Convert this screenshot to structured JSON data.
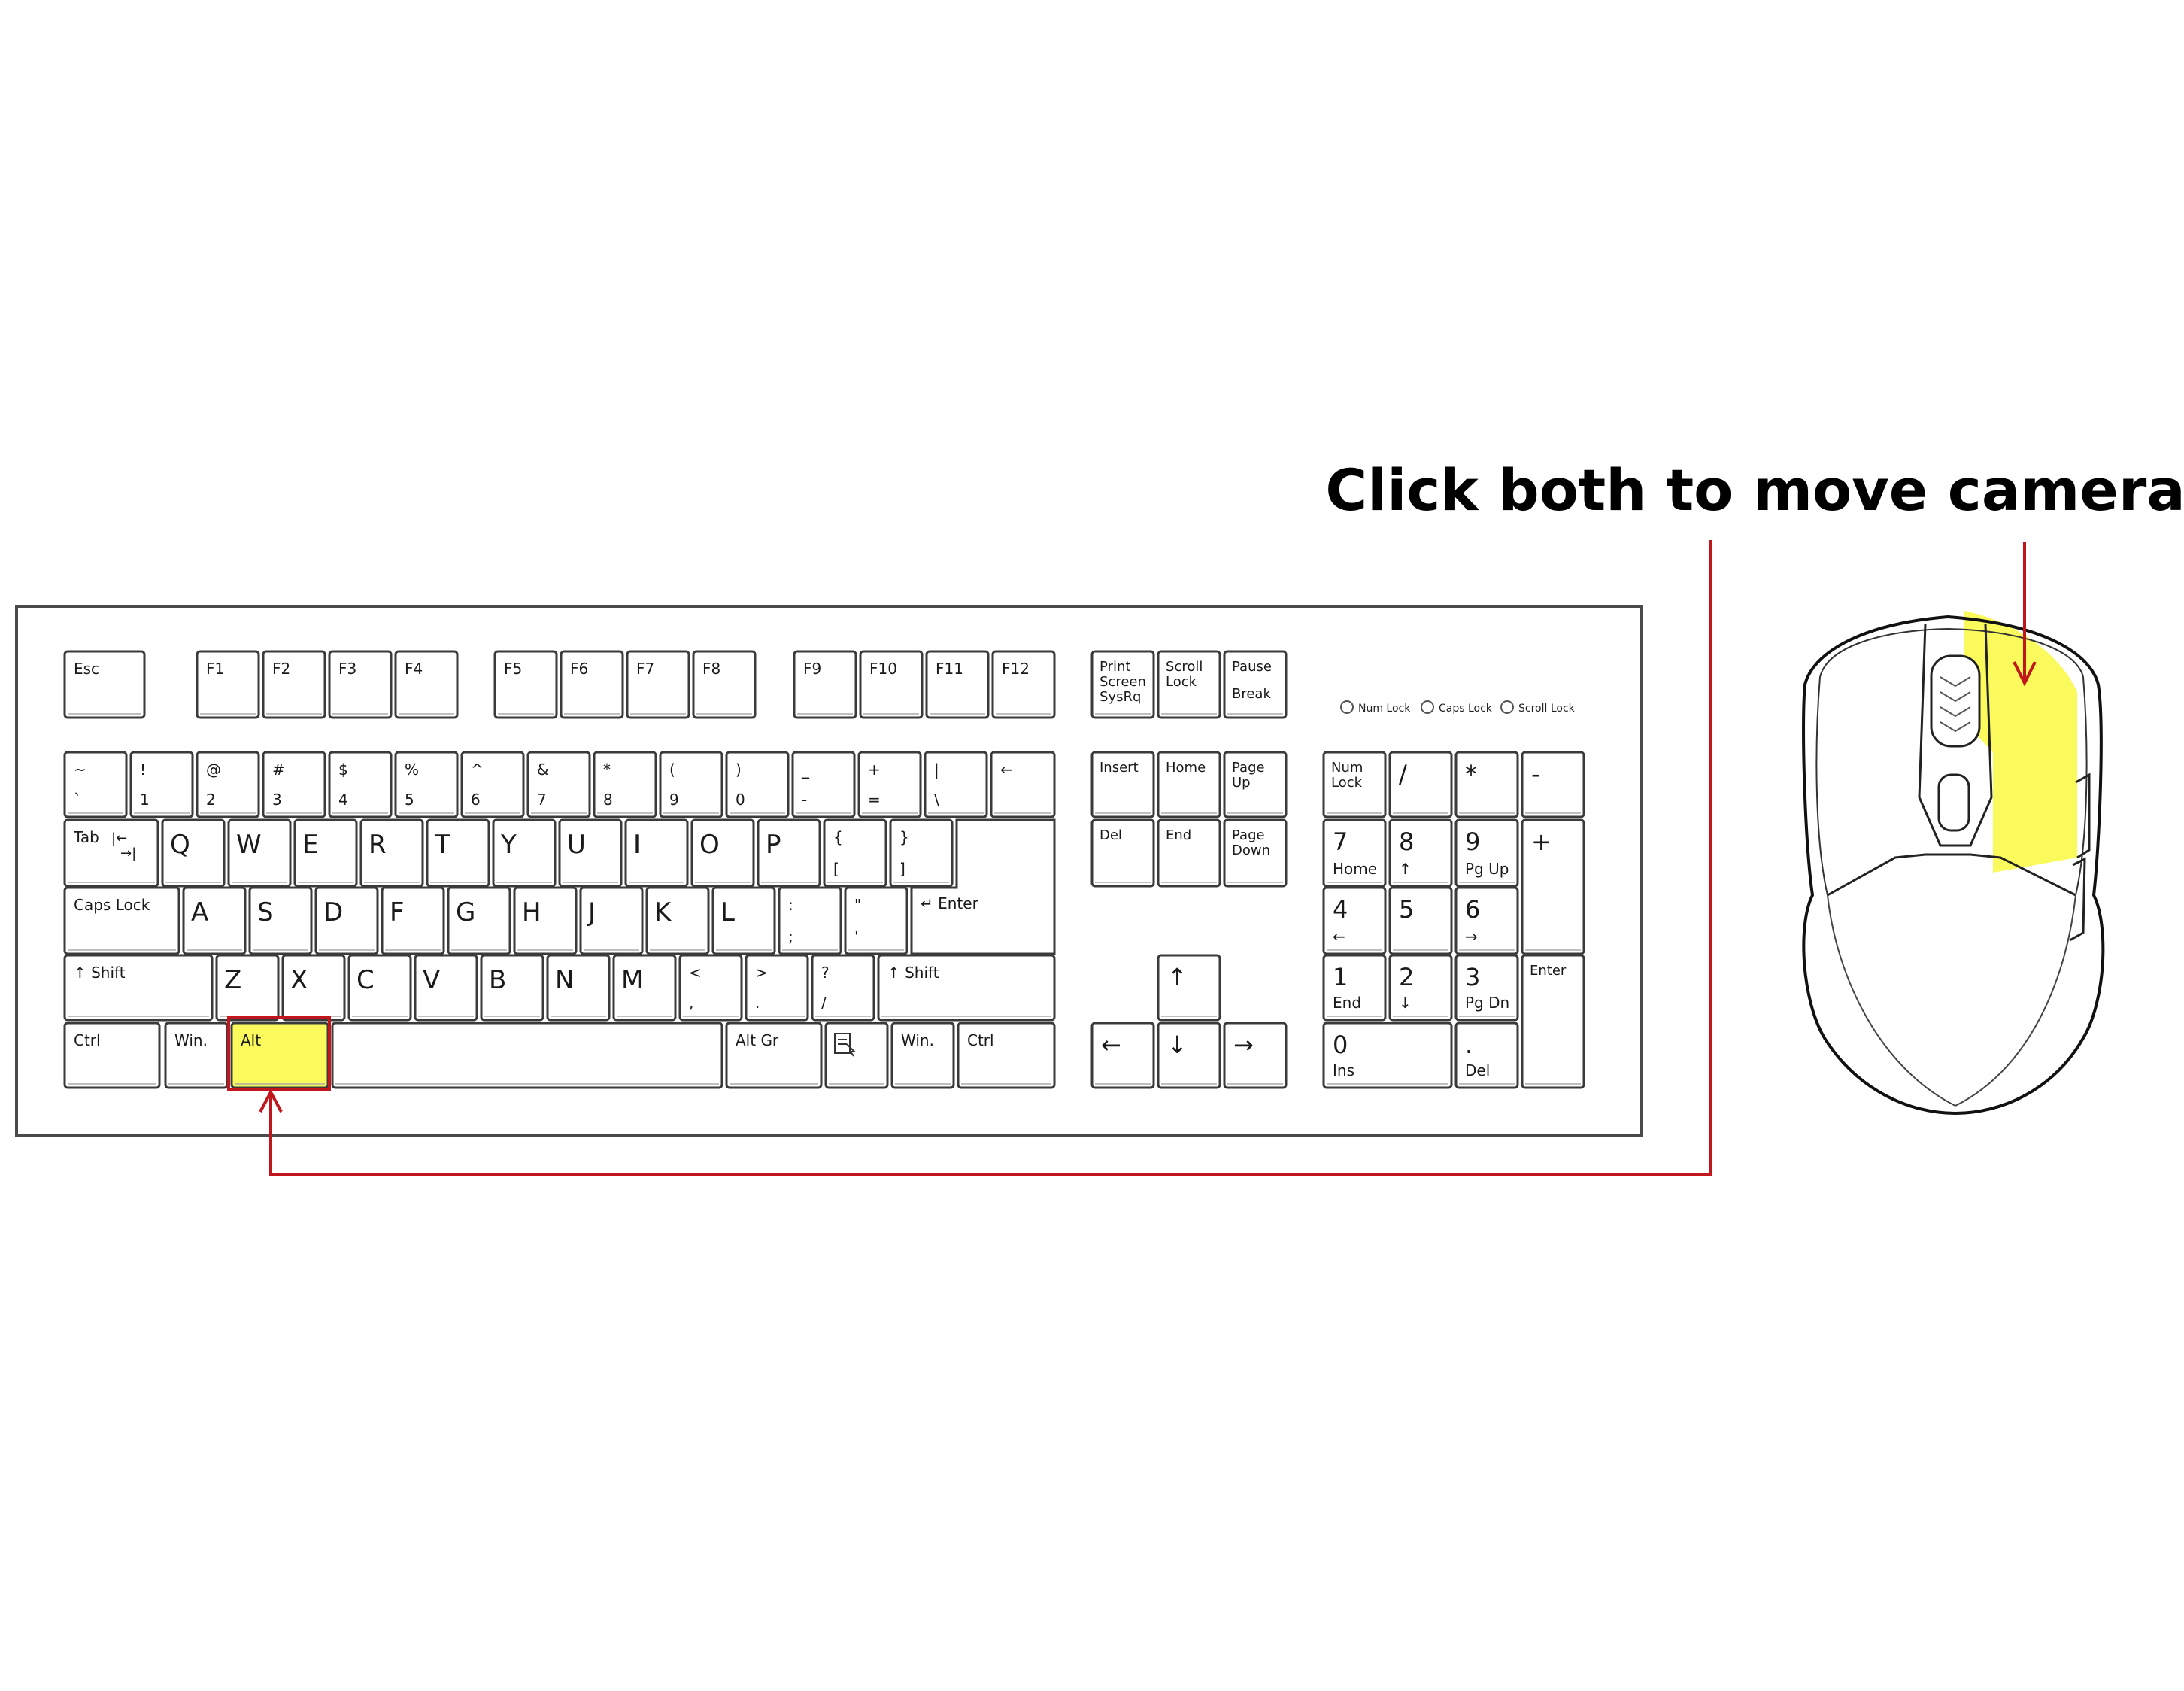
{
  "caption": "Click both to move camera",
  "colors": {
    "highlight": "#fbf94a",
    "arrow": "#c0161c",
    "outline": "#1a1a1a",
    "key_border": "#3a3a3a"
  },
  "indicators": [
    "Num Lock",
    "Caps Lock",
    "Scroll Lock"
  ],
  "keys": {
    "esc": "Esc",
    "f1": "F1",
    "f2": "F2",
    "f3": "F3",
    "f4": "F4",
    "f5": "F5",
    "f6": "F6",
    "f7": "F7",
    "f8": "F8",
    "f9": "F9",
    "f10": "F10",
    "f11": "F11",
    "f12": "F12",
    "prtsc_1": "Print",
    "prtsc_2": "Screen",
    "prtsc_3": "SysRq",
    "scroll_1": "Scroll",
    "scroll_2": "Lock",
    "pause_1": "Pause",
    "pause_2": "Break",
    "grave_top": "~",
    "grave_bot": "`",
    "n1_top": "!",
    "n1_bot": "1",
    "n2_top": "@",
    "n2_bot": "2",
    "n3_top": "#",
    "n3_bot": "3",
    "n4_top": "$",
    "n4_bot": "4",
    "n5_top": "%",
    "n5_bot": "5",
    "n6_top": "^",
    "n6_bot": "6",
    "n7_top": "&",
    "n7_bot": "7",
    "n8_top": "*",
    "n8_bot": "8",
    "n9_top": "(",
    "n9_bot": "9",
    "n0_top": ")",
    "n0_bot": "0",
    "minus_top": "_",
    "minus_bot": "-",
    "equal_top": "+",
    "equal_bot": "=",
    "pipe_top": "|",
    "pipe_bot": "\\",
    "backspace": "←",
    "insert": "Insert",
    "home": "Home",
    "pgup_1": "Page",
    "pgup_2": "Up",
    "numlock_1": "Num",
    "numlock_2": "Lock",
    "np_slash": "/",
    "np_star": "*",
    "np_minus": "-",
    "tab": "Tab",
    "tab_sym_1": "|←",
    "tab_sym_2": "→|",
    "q": "Q",
    "w": "W",
    "e": "E",
    "r": "R",
    "t": "T",
    "y": "Y",
    "u": "U",
    "i": "I",
    "o": "O",
    "p": "P",
    "lbr_top": "{",
    "lbr_bot": "[",
    "rbr_top": "}",
    "rbr_bot": "]",
    "del": "Del",
    "end": "End",
    "pgdn_1": "Page",
    "pgdn_2": "Down",
    "np7": "7",
    "np7_sub": "Home",
    "np8": "8",
    "np8_sub": "↑",
    "np9": "9",
    "np9_sub": "Pg Up",
    "np_plus": "+",
    "caps": "Caps Lock",
    "a": "A",
    "s": "S",
    "d": "D",
    "f": "F",
    "g": "G",
    "h": "H",
    "j": "J",
    "k": "K",
    "l": "L",
    "semi_top": ":",
    "semi_bot": ";",
    "quote_top": "\"",
    "quote_bot": "'",
    "enter": "↵ Enter",
    "np4": "4",
    "np4_sub": "←",
    "np5": "5",
    "np6": "6",
    "np6_sub": "→",
    "lshift": "↑ Shift",
    "z": "Z",
    "x": "X",
    "c": "C",
    "v": "V",
    "b": "B",
    "n": "N",
    "m": "M",
    "comma_top": "<",
    "comma_bot": ",",
    "period_top": ">",
    "period_bot": ".",
    "slash_top": "?",
    "slash_bot": "/",
    "rshift": "↑ Shift",
    "arrow_up": "↑",
    "np1": "1",
    "np1_sub": "End",
    "np2": "2",
    "np2_sub": "↓",
    "np3": "3",
    "np3_sub": "Pg Dn",
    "np_enter": "Enter",
    "lctrl": "Ctrl",
    "lwin": "Win.",
    "lalt": "Alt",
    "altgr": "Alt Gr",
    "rwin": "Win.",
    "rctrl": "Ctrl",
    "arrow_left": "←",
    "arrow_down": "↓",
    "arrow_right": "→",
    "np0": "0",
    "np0_sub": "Ins",
    "np_dot": ".",
    "np_dot_sub": "Del"
  },
  "icons": {
    "menu_key": "menu-key-icon",
    "mouse": "computer-mouse-icon"
  }
}
